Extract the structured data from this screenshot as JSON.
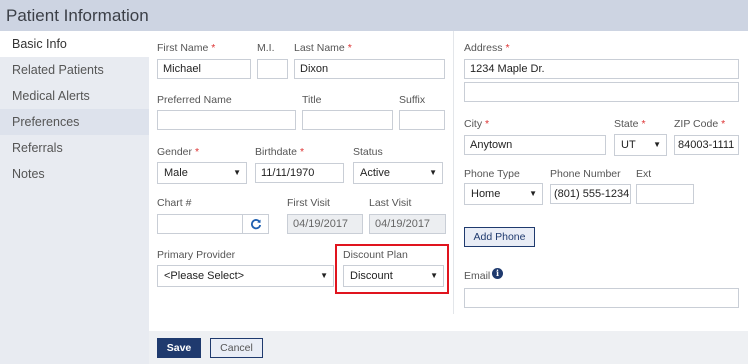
{
  "window": {
    "title": "Patient Information"
  },
  "sidebar": {
    "items": [
      {
        "label": "Basic Info"
      },
      {
        "label": "Related Patients"
      },
      {
        "label": "Medical Alerts"
      },
      {
        "label": "Preferences"
      },
      {
        "label": "Referrals"
      },
      {
        "label": "Notes"
      }
    ]
  },
  "form": {
    "first_name": {
      "label": "First Name",
      "value": "Michael",
      "required": "*"
    },
    "mi": {
      "label": "M.I.",
      "value": ""
    },
    "last_name": {
      "label": "Last Name",
      "value": "Dixon",
      "required": "*"
    },
    "preferred_name": {
      "label": "Preferred Name",
      "value": ""
    },
    "title": {
      "label": "Title",
      "value": ""
    },
    "suffix": {
      "label": "Suffix",
      "value": ""
    },
    "gender": {
      "label": "Gender",
      "value": "Male",
      "required": "*"
    },
    "birthdate": {
      "label": "Birthdate",
      "value": "11/11/1970",
      "required": "*"
    },
    "status": {
      "label": "Status",
      "value": "Active"
    },
    "chart": {
      "label": "Chart #",
      "value": ""
    },
    "first_visit": {
      "label": "First Visit",
      "value": "04/19/2017"
    },
    "last_visit": {
      "label": "Last Visit",
      "value": "04/19/2017"
    },
    "primary_provider": {
      "label": "Primary Provider",
      "value": "<Please Select>"
    },
    "discount_plan": {
      "label": "Discount Plan",
      "value": "Discount"
    }
  },
  "contact": {
    "address": {
      "label": "Address",
      "line1": "1234 Maple Dr.",
      "line2": "",
      "required": "*"
    },
    "city": {
      "label": "City",
      "value": "Anytown",
      "required": "*"
    },
    "state": {
      "label": "State",
      "value": "UT",
      "required": "*"
    },
    "zip": {
      "label": "ZIP Code",
      "value": "84003-1111",
      "required": "*"
    },
    "phone_type": {
      "label": "Phone Type",
      "value": "Home"
    },
    "phone_number": {
      "label": "Phone Number",
      "value": "(801) 555-1234"
    },
    "ext": {
      "label": "Ext",
      "value": ""
    },
    "add_phone": "Add Phone",
    "email": {
      "label": "Email",
      "value": ""
    }
  },
  "footer": {
    "save": "Save",
    "cancel": "Cancel"
  },
  "colors": {
    "accent": "#1f3a6e",
    "highlight": "#e0141e",
    "required": "#dd3333"
  }
}
